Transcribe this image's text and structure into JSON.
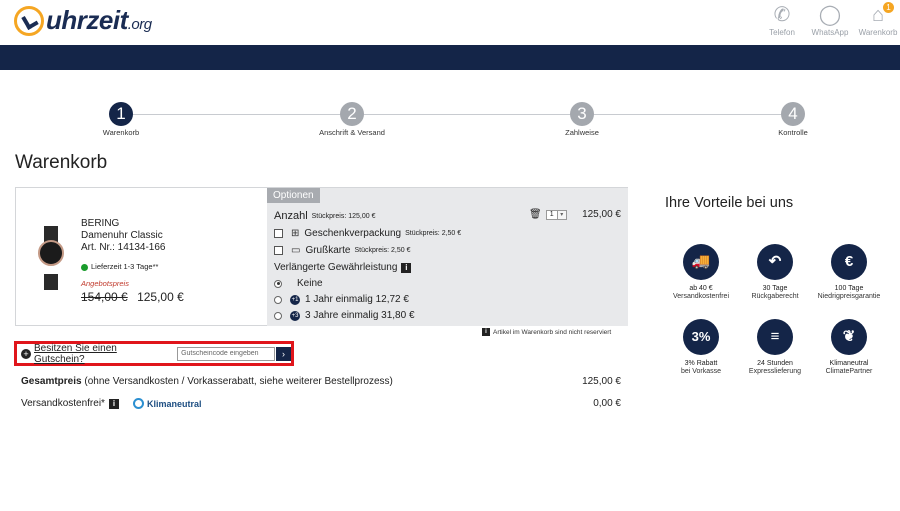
{
  "header": {
    "logo_text": "uhrzeit",
    "logo_tld": ".org",
    "icons": [
      {
        "icon": "phone-icon",
        "label": "Telefon"
      },
      {
        "icon": "whatsapp-icon",
        "label": "WhatsApp"
      },
      {
        "icon": "cart-icon",
        "label": "Warenkorb",
        "badge": "1"
      }
    ]
  },
  "steps": [
    {
      "num": "1",
      "label": "Warenkorb",
      "active": true
    },
    {
      "num": "2",
      "label": "Anschrift & Versand",
      "active": false
    },
    {
      "num": "3",
      "label": "Zahlweise",
      "active": false
    },
    {
      "num": "4",
      "label": "Kontrolle",
      "active": false
    }
  ],
  "page_title": "Warenkorb",
  "product": {
    "brand": "BERING",
    "name": "Damenuhr Classic",
    "article": "Art. Nr.: 14134-166",
    "delivery": "Lieferzeit 1-3 Tage**",
    "offer_label": "Angebotspreis",
    "old_price": "154,00 €",
    "price": "125,00 €"
  },
  "options": {
    "tab_label": "Optionen",
    "anzahl_label": "Anzahl",
    "anzahl_unit": "Stückpreis: 125,00 €",
    "quantity": "1",
    "line_price": "125,00 €",
    "gift_wrap": "Geschenkverpackung",
    "gift_wrap_price": "Stückpreis: 2,50 €",
    "greeting_card": "Grußkarte",
    "greeting_card_price": "Stückpreis: 2,50 €",
    "warranty_title": "Verlängerte Gewährleistung",
    "warranty_options": [
      {
        "label": "Keine",
        "selected": true,
        "badge": ""
      },
      {
        "label": "1 Jahr einmalig 12,72 €",
        "selected": false,
        "badge": "+1"
      },
      {
        "label": "3 Jahre einmalig 31,80 €",
        "selected": false,
        "badge": "+3"
      }
    ]
  },
  "reserve_note": "Artikel im Warenkorb sind nicht reserviert",
  "voucher": {
    "link": "Besitzen Sie einen Gutschein?",
    "placeholder": "Gutscheincode eingeben"
  },
  "totals": {
    "total_label_bold": "Gesamtpreis",
    "total_label_rest": " (ohne Versandkosten / Vorkasserabatt, siehe weiterer Bestellprozess)",
    "total_value": "125,00 €",
    "shipping_label": "Versandkostenfrei*",
    "klima_label": "Klimaneutral",
    "shipping_value": "0,00 €"
  },
  "vorteile": {
    "title": "Ihre Vorteile bei uns",
    "items": [
      {
        "icon": "truck-icon",
        "glyph": "🚚",
        "line1": "ab 40 €",
        "line2": "Versandkostenfrei"
      },
      {
        "icon": "return-icon",
        "glyph": "↶",
        "line1": "30 Tage",
        "line2": "Rückgaberecht"
      },
      {
        "icon": "euro-icon",
        "glyph": "€",
        "line1": "100 Tage",
        "line2": "Niedrigpreisgarantie"
      },
      {
        "icon": "percent-icon",
        "glyph": "3%",
        "line1": "3% Rabatt",
        "line2": "bei Vorkasse"
      },
      {
        "icon": "express-icon",
        "glyph": "≡",
        "line1": "24 Stunden",
        "line2": "Expresslieferung"
      },
      {
        "icon": "leaf-icon",
        "glyph": "❦",
        "line1": "Klimaneutral",
        "line2": "ClimatePartner"
      }
    ]
  }
}
